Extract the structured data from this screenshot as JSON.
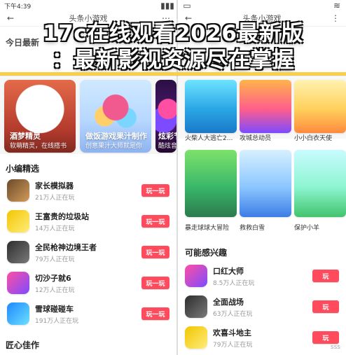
{
  "title": {
    "line1": "17c在线观看2026最新版",
    "line2": "：最新影视资源尽在掌握"
  },
  "left_phone": {
    "status_time": "下午4:39",
    "appbar_title": "头条小游戏",
    "section_today": "今日最新",
    "hero_cards": [
      {
        "title": "酒梦精灵",
        "subtitle": "软萌精灵，在线搭书"
      },
      {
        "title": "做饭游戏果汁制作",
        "subtitle": "创意果汁大师就是你"
      },
      {
        "title": "炫彩节",
        "subtitle": "酷炫音乐节"
      }
    ],
    "section_editor": "小编精选",
    "editor_list": [
      {
        "name": "家长模拟器",
        "meta": "21万人正在玩",
        "action": "玩一玩",
        "icon": "pixel-character-icon"
      },
      {
        "name": "王富贵的垃圾站",
        "meta": "14万人正在玩",
        "action": "玩一玩",
        "icon": "cartoon-face-icon"
      },
      {
        "name": "全民枪神边境王者",
        "meta": "79万人正在玩",
        "action": "玩一玩",
        "icon": "shooter-soldier-icon"
      },
      {
        "name": "切沙子就6",
        "meta": "12万人正在玩",
        "action": "玩一玩",
        "icon": "purple-block-icon"
      },
      {
        "name": "雪球碰碰车",
        "meta": "191万人正在玩",
        "action": "玩一玩",
        "icon": "snowball-car-icon"
      }
    ],
    "bottom_section": "匠心佳作"
  },
  "right_phone": {
    "appbar_title": "头条小游戏",
    "top_tiles": [
      {
        "label": "火柴人大逃亡2..."
      },
      {
        "label": "攻城总动员"
      },
      {
        "label": "小小白衣天使"
      }
    ],
    "mid_tiles": [
      {
        "label": "暴走球球大冒险"
      },
      {
        "label": "救救白雪"
      },
      {
        "label": "保护小羊"
      }
    ],
    "section_like": "可能感兴趣",
    "like_list": [
      {
        "name": "口红大师",
        "meta": "8.5万人正在玩",
        "action": "玩",
        "icon": "lipstick-icon"
      },
      {
        "name": "全面战场",
        "meta": "63万人正在玩",
        "action": "玩",
        "icon": "battle-icon"
      },
      {
        "name": "欢喜斗地主",
        "meta": "79万人正在玩",
        "action": "玩",
        "icon": "cards-icon"
      }
    ],
    "watermark": "sss"
  }
}
